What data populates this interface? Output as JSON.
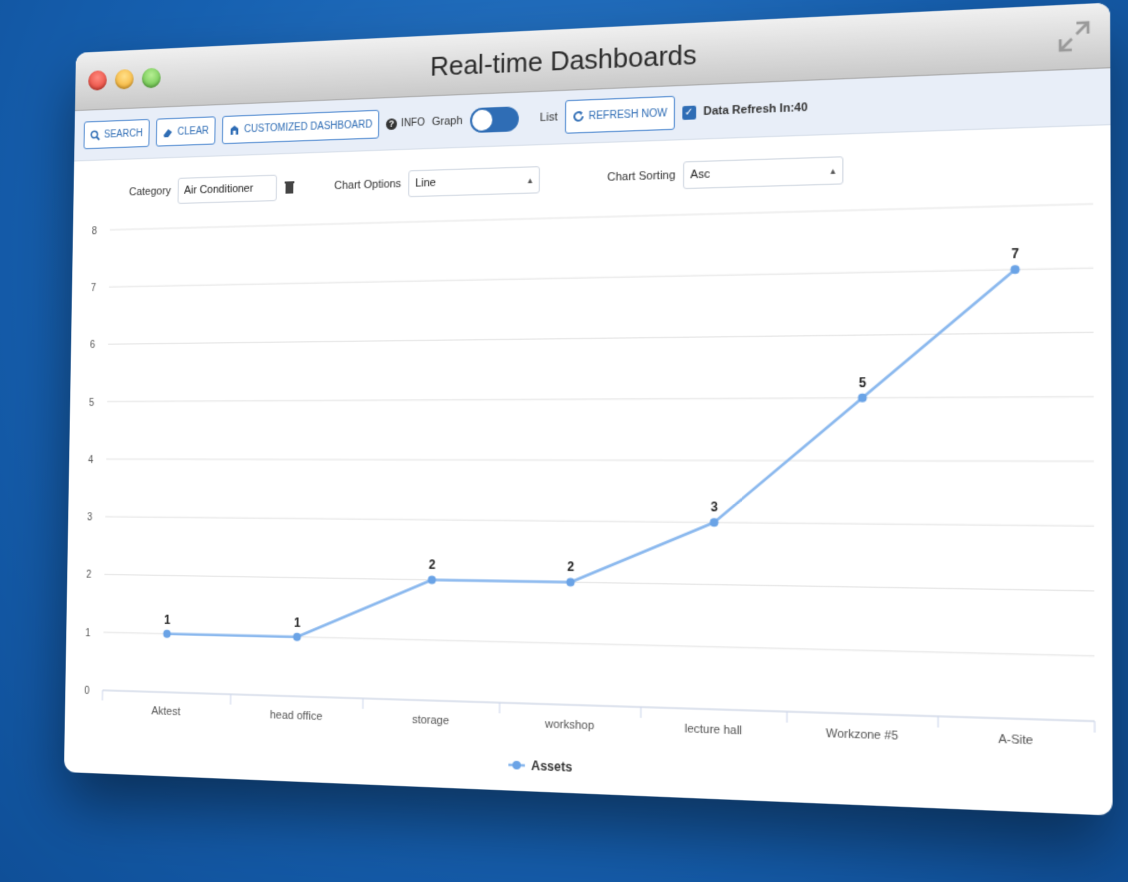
{
  "window": {
    "title": "Real-time Dashboards"
  },
  "toolbar": {
    "search_label": "SEARCH",
    "clear_label": "CLEAR",
    "customized_label": "CUSTOMIZED DASHBOARD",
    "info_label": "INFO",
    "graph_label": "Graph",
    "list_label": "List",
    "refresh_label": "REFRESH NOW",
    "data_refresh_label": "Data Refresh In:40"
  },
  "filters": {
    "category_label": "Category",
    "category_value": "Air Conditioner",
    "chart_options_label": "Chart Options",
    "chart_options_value": "Line",
    "chart_sorting_label": "Chart Sorting",
    "chart_sorting_value": "Asc"
  },
  "colors": {
    "accent": "#2f6db5",
    "line": "#8ab8ee",
    "point": "#6aa3e6"
  },
  "chart_data": {
    "type": "line",
    "categories": [
      "Aktest",
      "head office",
      "storage",
      "workshop",
      "lecture hall",
      "Workzone #5",
      "A-Site"
    ],
    "series": [
      {
        "name": "Assets",
        "values": [
          1,
          1,
          2,
          2,
          3,
          5,
          7
        ]
      }
    ],
    "ylim": [
      0,
      8
    ],
    "yticks": [
      0,
      1,
      2,
      3,
      4,
      5,
      6,
      7,
      8
    ],
    "grid": true,
    "legend": "bottom-center",
    "data_labels": true
  }
}
